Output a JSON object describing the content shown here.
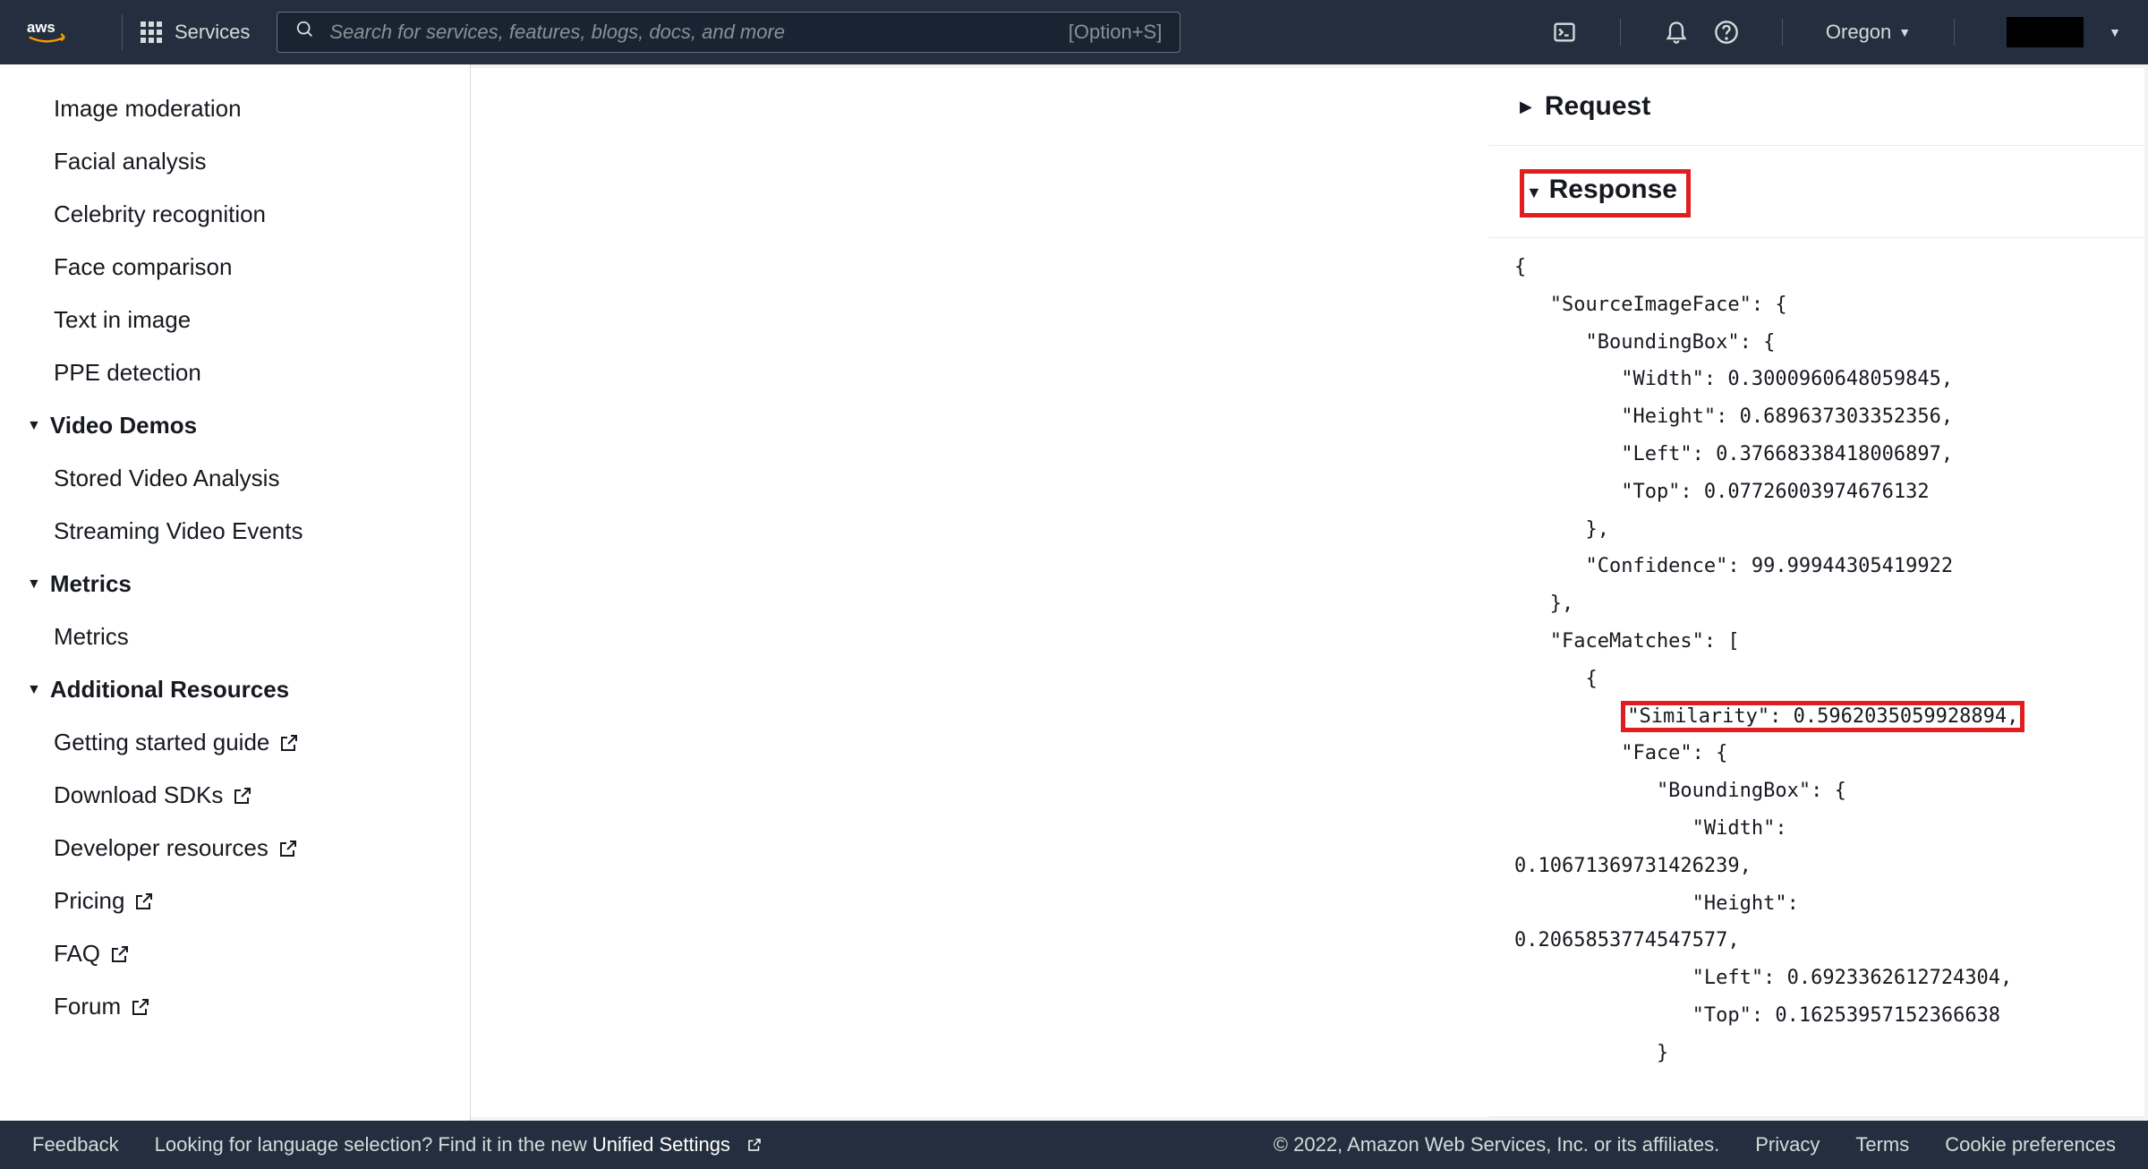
{
  "topnav": {
    "services_label": "Services",
    "search_placeholder": "Search for services, features, blogs, docs, and more",
    "search_shortcut": "[Option+S]",
    "region": "Oregon"
  },
  "sidebar": {
    "items_demos": [
      "Image moderation",
      "Facial analysis",
      "Celebrity recognition",
      "Face comparison",
      "Text in image",
      "PPE detection"
    ],
    "section_video": "Video Demos",
    "items_video": [
      "Stored Video Analysis",
      "Streaming Video Events"
    ],
    "section_metrics": "Metrics",
    "items_metrics": [
      "Metrics"
    ],
    "section_resources": "Additional Resources",
    "items_resources": [
      "Getting started guide",
      "Download SDKs",
      "Developer resources",
      "Pricing",
      "FAQ",
      "Forum"
    ]
  },
  "rightpanel": {
    "request_title": "Request",
    "response_title": "Response",
    "response_body_lines": [
      "{",
      "   \"SourceImageFace\": {",
      "      \"BoundingBox\": {",
      "         \"Width\": 0.3000960648059845,",
      "         \"Height\": 0.689637303352356,",
      "         \"Left\": 0.37668338418006897,",
      "         \"Top\": 0.07726003974676132",
      "      },",
      "      \"Confidence\": 99.99944305419922",
      "   },",
      "   \"FaceMatches\": [",
      "      {",
      "         \"Similarity\": 0.5962035059928894,",
      "         \"Face\": {",
      "            \"BoundingBox\": {",
      "               \"Width\": ",
      "0.10671369731426239,",
      "               \"Height\": ",
      "0.2065853774547577,",
      "               \"Left\": 0.6923362612724304,",
      "               \"Top\": 0.16253957152366638",
      "            }"
    ],
    "similarity_line_index": 12
  },
  "footer": {
    "feedback": "Feedback",
    "lang_text_prefix": "Looking for language selection? Find it in the new ",
    "lang_link": "Unified Settings",
    "copyright": "© 2022, Amazon Web Services, Inc. or its affiliates.",
    "privacy": "Privacy",
    "terms": "Terms",
    "cookies": "Cookie preferences"
  }
}
